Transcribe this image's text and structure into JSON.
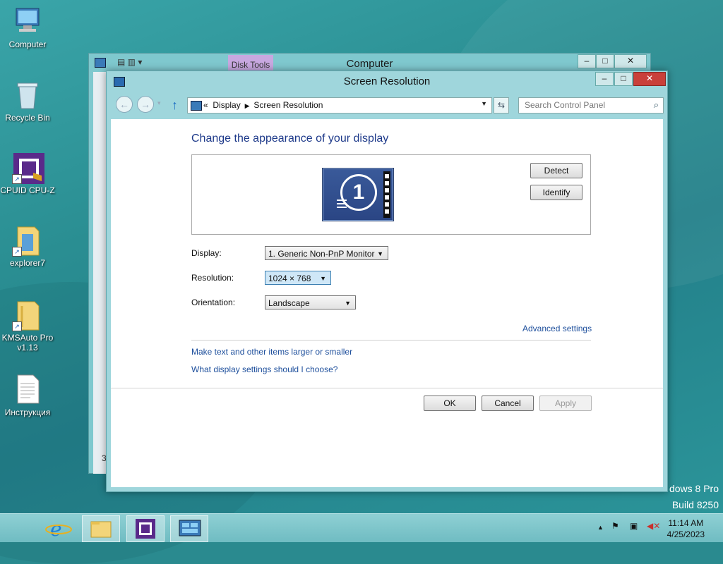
{
  "desktop": {
    "icons": [
      {
        "label": "Computer"
      },
      {
        "label": "Recycle Bin"
      },
      {
        "label": "CPUID CPU-Z"
      },
      {
        "label": "explorer7"
      },
      {
        "label": "KMSAuto Pro v1.13"
      },
      {
        "label": "Инструкция"
      }
    ],
    "watermark_line1": "dows 8 Pro",
    "watermark_line2": "Build 8250"
  },
  "back_window": {
    "title": "Computer",
    "ribbon_tab": "Disk Tools",
    "status_fragment": "3"
  },
  "dialog": {
    "title": "Screen Resolution",
    "breadcrumb": [
      "Display",
      "Screen Resolution"
    ],
    "breadcrumb_prefix": "«",
    "search_placeholder": "Search Control Panel",
    "heading": "Change the appearance of your display",
    "monitor_number": "1",
    "detect_label": "Detect",
    "identify_label": "Identify",
    "display_label": "Display:",
    "display_value": "1. Generic Non-PnP Monitor",
    "resolution_label": "Resolution:",
    "resolution_value": "1024 × 768",
    "orientation_label": "Orientation:",
    "orientation_value": "Landscape",
    "advanced_link": "Advanced settings",
    "link_text_size": "Make text and other items larger or smaller",
    "link_help": "What display settings should I choose?",
    "ok_label": "OK",
    "cancel_label": "Cancel",
    "apply_label": "Apply"
  },
  "taskbar": {
    "time": "11:14 AM",
    "date": "4/25/2023"
  },
  "colors": {
    "link": "#1e4f9c",
    "heading": "#1e3a8a",
    "close": "#c9403a"
  }
}
